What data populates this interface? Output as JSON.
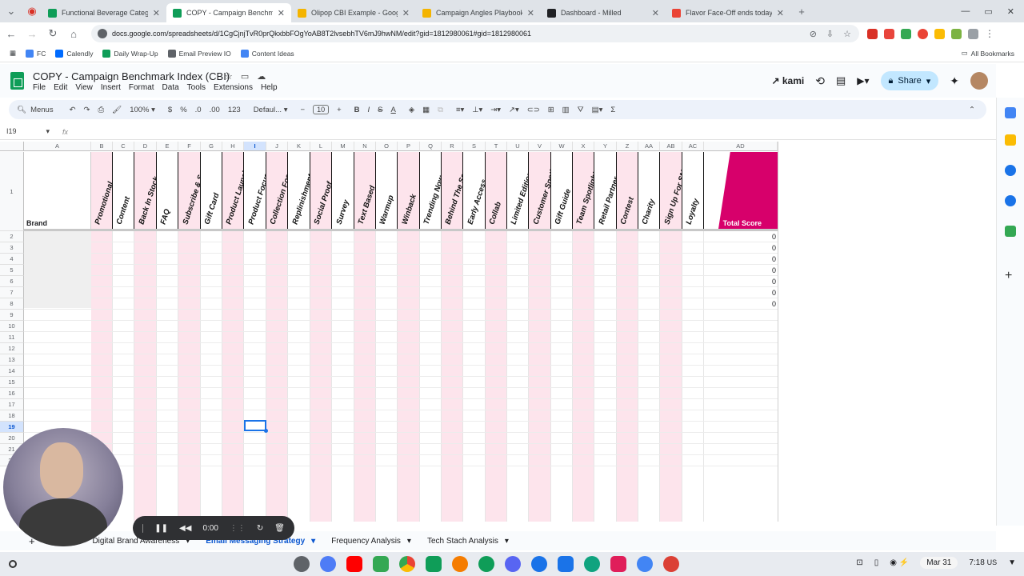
{
  "browser": {
    "tabs": [
      {
        "title": "Functional Beverage Category",
        "favicon_color": "#0f9d58"
      },
      {
        "title": "COPY - Campaign Benchm",
        "favicon_color": "#0f9d58",
        "active": true
      },
      {
        "title": "Olipop CBI Example - Google S",
        "favicon_color": "#f4b400"
      },
      {
        "title": "Campaign Angles Playbook - G",
        "favicon_color": "#f4b400"
      },
      {
        "title": "Dashboard - Milled",
        "favicon_color": "#202124"
      },
      {
        "title": "Flavor Face-Off ends today! 🍊",
        "favicon_color": "#ea4335"
      }
    ],
    "url": "docs.google.com/spreadsheets/d/1CgCjnjTvR0prQkxbbFOgYoAB8T2lvsebhTV6mJ9hwNM/edit?gid=1812980061#gid=1812980061",
    "bookmarks": [
      {
        "label": "FC",
        "color": "#4285f4"
      },
      {
        "label": "Calendly",
        "color": "#006bff"
      },
      {
        "label": "Daily Wrap-Up",
        "color": "#0f9d58"
      },
      {
        "label": "Email Preview IO",
        "color": "#5f6368"
      },
      {
        "label": "Content Ideas",
        "color": "#4285f4"
      }
    ],
    "all_bookmarks": "All Bookmarks"
  },
  "sheet": {
    "title": "COPY - Campaign Benchmark Index (CBI)",
    "menus": [
      "File",
      "Edit",
      "View",
      "Insert",
      "Format",
      "Data",
      "Tools",
      "Extensions",
      "Help"
    ],
    "kami": "kami",
    "share": "Share",
    "toolbar": {
      "menus": "Menus",
      "zoom": "100%",
      "currency": "$",
      "percent": "%",
      "dec_decrease": ".0",
      "dec_increase": ".00",
      "number_format": "123",
      "font": "Defaul...",
      "font_size": "10"
    },
    "name_box": "I19",
    "fx": "fx",
    "columns": [
      "A",
      "B",
      "C",
      "D",
      "E",
      "F",
      "G",
      "H",
      "I",
      "J",
      "K",
      "L",
      "M",
      "N",
      "O",
      "P",
      "Q",
      "R",
      "S",
      "T",
      "U",
      "V",
      "W",
      "X",
      "Y",
      "Z",
      "AA",
      "AB",
      "AC",
      "AD"
    ],
    "brand_header": "Brand",
    "categories": [
      "Promotional",
      "Content",
      "Back In Stock",
      "FAQ",
      "Subscribe & Save",
      "Gift Card",
      "Product Launch",
      "Product Focused",
      "Collection Focused",
      "Replinishment",
      "Social Proof",
      "Survey",
      "Text Based",
      "Warmup",
      "Winback",
      "Trending Now",
      "Behind The Scens",
      "Early Access",
      "Collab",
      "Limited Edition",
      "Customer Spotlight",
      "Gift Guide",
      "Team Spotlight",
      "Retail Partner",
      "Contest",
      "Charity",
      "Sign Up For SMS",
      "Loyalty"
    ],
    "total_header": "Total Score",
    "rows": [
      "1",
      "2",
      "3",
      "4",
      "5",
      "6",
      "7",
      "8",
      "9",
      "10",
      "11",
      "12",
      "13",
      "14",
      "15",
      "16",
      "17",
      "18",
      "19",
      "20",
      "21",
      "22"
    ],
    "total_scores": [
      "0",
      "0",
      "0",
      "0",
      "0",
      "0",
      "0"
    ],
    "selected_row": "19",
    "selected_col": "I",
    "accent_color": "#d7006b",
    "pink_column_color": "#fde4ec",
    "sheet_tabs": [
      {
        "label": "Digital Brand Awareness",
        "active": false
      },
      {
        "label": "Email Messaging Strategy",
        "active": true
      },
      {
        "label": "Frequency Analysis",
        "active": false
      },
      {
        "label": "Tech Stach Analysis",
        "active": false
      }
    ]
  },
  "recorder": {
    "time": "0:00"
  },
  "shelf": {
    "date": "Mar 31",
    "time": "7:18",
    "locale": "US"
  }
}
